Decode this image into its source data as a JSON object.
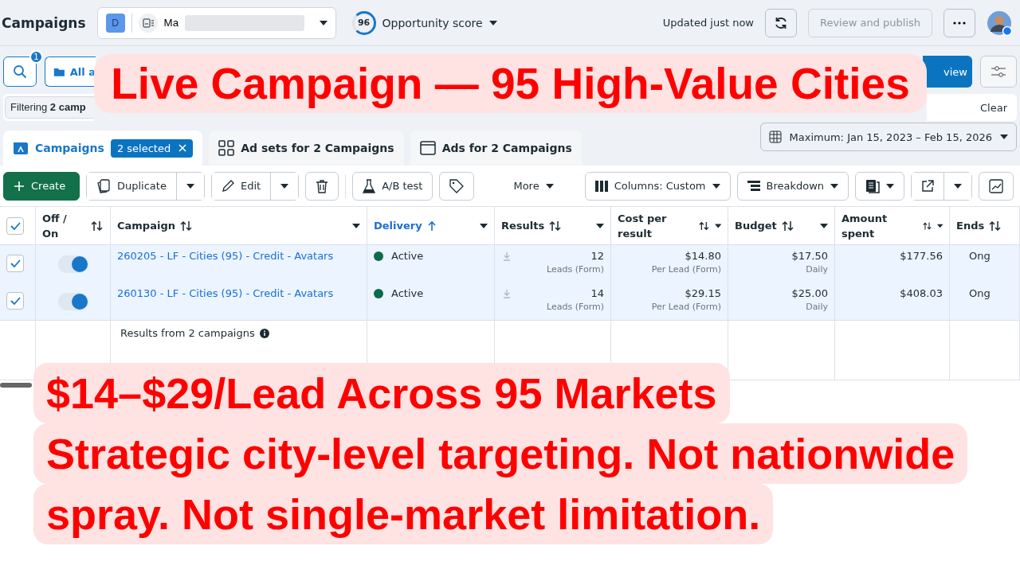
{
  "header": {
    "title": "Campaigns",
    "account": {
      "initial": "D",
      "name": "Ma"
    },
    "opportunity": {
      "score": "96",
      "label": "Opportunity score"
    },
    "status": "Updated just now",
    "publish": {
      "label": "Review and publish",
      "disabled": true
    }
  },
  "quick_filters": {
    "search_badge": "1",
    "chips": [
      {
        "label": "All a",
        "selected": true
      }
    ],
    "create_view": "view"
  },
  "filter_bar": {
    "chip": "Filtering **2 camp**",
    "clear": "Clear"
  },
  "tabs": [
    {
      "label": "Campaigns",
      "selected": true,
      "badge": "2 selected"
    },
    {
      "label": "Ad sets for 2 Campaigns",
      "selected": false
    },
    {
      "label": "Ads for 2 Campaigns",
      "selected": false
    }
  ],
  "date_range": "Maximum: Jan 15, 2023 – Feb 15, 2026",
  "toolbar": {
    "create": "Create",
    "duplicate": "Duplicate",
    "edit": "Edit",
    "ab_test": "A/B test",
    "more": "More",
    "columns": "Columns: Custom",
    "breakdown": "Breakdown"
  },
  "table": {
    "all_selected": true,
    "columns": [
      {
        "label": "Off / On",
        "sorted": false,
        "active": false,
        "menu": false
      },
      {
        "label": "Campaign",
        "sorted": false,
        "active": false,
        "menu": true
      },
      {
        "label": "Delivery",
        "sorted": true,
        "active": true,
        "menu": true
      },
      {
        "label": "Results",
        "sorted": false,
        "active": false,
        "menu": true
      },
      {
        "label": "Cost per result",
        "sorted": false,
        "active": false,
        "menu": true
      },
      {
        "label": "Budget",
        "sorted": false,
        "active": false,
        "menu": true
      },
      {
        "label": "Amount spent",
        "sorted": false,
        "active": false,
        "menu": true
      },
      {
        "label": "Ends",
        "sorted": false,
        "active": false,
        "menu": false
      }
    ],
    "rows": [
      {
        "selected": true,
        "on": true,
        "name": "260205 - LF - Cities (95) - Credit - Avatars",
        "delivery": "Active",
        "color": "#0b6b4a",
        "results": "12",
        "results_note": "Leads (Form)",
        "cost": "$14.80",
        "cost_note": "Per Lead (Form)",
        "budget": "$17.50",
        "budget_note": "Daily",
        "spent": "$177.56",
        "ends": "Ong"
      },
      {
        "selected": true,
        "on": true,
        "name": "260130 - LF - Cities (95) - Credit - Avatars",
        "delivery": "Active",
        "color": "#0b6b4a",
        "results": "14",
        "results_note": "Leads (Form)",
        "cost": "$29.15",
        "cost_note": "Per Lead (Form)",
        "budget": "$25.00",
        "budget_note": "Daily",
        "spent": "$408.03",
        "ends": "Ong"
      }
    ],
    "summary": "Results from 2 campaigns"
  },
  "captions": {
    "title": "Live Campaign — 95 High-Value Cities",
    "headline": "$14–$29/Lead Across 95 Markets",
    "text_lines": [
      "Strategic city-level targeting. Not nationwide",
      "spray. Not single-market limitation."
    ]
  }
}
